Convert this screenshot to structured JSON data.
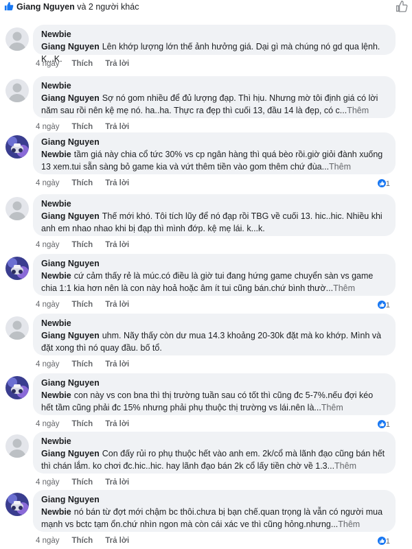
{
  "header": {
    "first_liker": "Giang Nguyen",
    "others": "và 2 người khác"
  },
  "colors": {
    "accent": "#1877f2",
    "bubble": "#f0f2f5",
    "meta": "#65676b"
  },
  "actions": {
    "like": "Thích",
    "reply": "Trả lời",
    "more": "Thêm"
  },
  "comments": [
    {
      "author": "Newbie",
      "avatar": "default",
      "mention": "Giang Nguyen",
      "text": "Lên khớp lượng lớn thế ảnh hưởng giá. Dại gì mà chúng nó gd qua lệnh. K...K.",
      "more": false,
      "time": "4 ngày",
      "likes": ""
    },
    {
      "author": "Newbie",
      "avatar": "default",
      "mention": "Giang Nguyen",
      "text": "Sợ nó gom nhiều để đủ lượng đạp. Thì hịu. Nhưng mờ tôi định giá có lời năm sau rồi nên kệ mẹ nó. ha..ha. Thực ra đẹp thì cuối 13, đầu 14 là đẹp, có c...",
      "more": true,
      "time": "4 ngày",
      "likes": ""
    },
    {
      "author": "Giang Nguyen",
      "avatar": "photo",
      "mention": "Newbie",
      "text": "tầm giá này chia cổ tức 30% vs cp ngân hàng thì quá bèo rồi.giờ giỏi đành xuống 13 xem.tui sẵn sàng bỏ game kia và vứt thêm tiền vào gom thêm chứ đùa...",
      "more": true,
      "time": "4 ngày",
      "likes": "1"
    },
    {
      "author": "Newbie",
      "avatar": "default",
      "mention": "Giang Nguyen",
      "text": "Thế mới khó. Tôi tích lũy để nó đạp rồi TBG về cuối 13. hic..hic. Nhiều khi anh em nhao nhao khi bị đạp thì mình đớp. kệ mẹ lái. k...k.",
      "more": false,
      "time": "4 ngày",
      "likes": ""
    },
    {
      "author": "Giang Nguyen",
      "avatar": "photo",
      "mention": "Newbie",
      "text": "cứ cảm thấy rẻ là múc.có điều là giờ tui đang hứng game chuyển sàn vs game chia 1:1 kia hơn nên là con này hoả hoặc âm ít tui cũng bán.chứ bình thườ...",
      "more": true,
      "time": "4 ngày",
      "likes": "1"
    },
    {
      "author": "Newbie",
      "avatar": "default",
      "mention": "Giang Nguyen",
      "text": "uhm. Nãy thấy còn dư mua 14.3 khoảng 20-30k đặt mà ko khớp. Mình và đặt xong thì nó quay đầu. bố tổ.",
      "more": false,
      "time": "4 ngày",
      "likes": ""
    },
    {
      "author": "Giang Nguyen",
      "avatar": "photo",
      "mention": "Newbie",
      "text": "con này vs con bna thì thị trường tuần sau có tốt thì cũng đc 5-7%.nếu đợi kéo hết tầm cũng phải đc 15% nhưng phải phụ thuộc thị trường vs lái.nên là...",
      "more": true,
      "time": "4 ngày",
      "likes": "1"
    },
    {
      "author": "Newbie",
      "avatar": "default",
      "mention": "Giang Nguyen",
      "text": "Con đấy rủi ro phụ thuộc hết vào anh em. 2k/cổ mà lãnh đạo cũng bán hết thì chán lắm. ko chơi đc.hic..hic. hay lãnh đạo bán 2k cổ lấy tiền chờ về 1.3...",
      "more": true,
      "time": "4 ngày",
      "likes": ""
    },
    {
      "author": "Giang Nguyen",
      "avatar": "photo",
      "mention": "Newbie",
      "text": "nó bán từ đợt mới chậm bc thôi.chưa bị bạn chế.quan trọng là vẫn có người mua mạnh vs bctc tạm ổn.chứ nhìn ngon mà còn cái xác ve thì cũng hỏng.nhưng...",
      "more": true,
      "time": "4 ngày",
      "likes": "1"
    }
  ]
}
